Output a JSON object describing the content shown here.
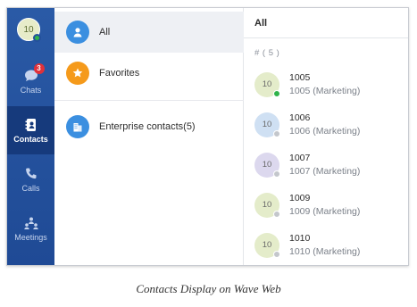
{
  "user": {
    "avatar_text": "10",
    "status_color": "#2fb34a"
  },
  "nav": {
    "chats": {
      "label": "Chats",
      "badge": "3"
    },
    "contacts": {
      "label": "Contacts"
    },
    "calls": {
      "label": "Calls"
    },
    "meetings": {
      "label": "Meetings"
    }
  },
  "categories": {
    "all": {
      "label": "All",
      "color": "#3b8fe0"
    },
    "favorites": {
      "label": "Favorites",
      "color": "#f59a1b"
    },
    "enterprise": {
      "label": "Enterprise contacts(5)",
      "color": "#3b8fe0"
    }
  },
  "list": {
    "title": "All",
    "group_label": "# ( 5 )",
    "contacts": [
      {
        "avatar": "10",
        "name": "1005",
        "sub": "1005 (Marketing)",
        "avatar_color": "#e4ecca",
        "status_color": "#2fb34a"
      },
      {
        "avatar": "10",
        "name": "1006",
        "sub": "1006 (Marketing)",
        "avatar_color": "#cfe0f3",
        "status_color": "#c4c7cc"
      },
      {
        "avatar": "10",
        "name": "1007",
        "sub": "1007 (Marketing)",
        "avatar_color": "#dcd8ee",
        "status_color": "#c4c7cc"
      },
      {
        "avatar": "10",
        "name": "1009",
        "sub": "1009 (Marketing)",
        "avatar_color": "#e4ecca",
        "status_color": "#c4c7cc"
      },
      {
        "avatar": "10",
        "name": "1010",
        "sub": "1010 (Marketing)",
        "avatar_color": "#e4ecca",
        "status_color": "#c4c7cc"
      }
    ]
  },
  "caption": "Contacts Display on Wave Web"
}
